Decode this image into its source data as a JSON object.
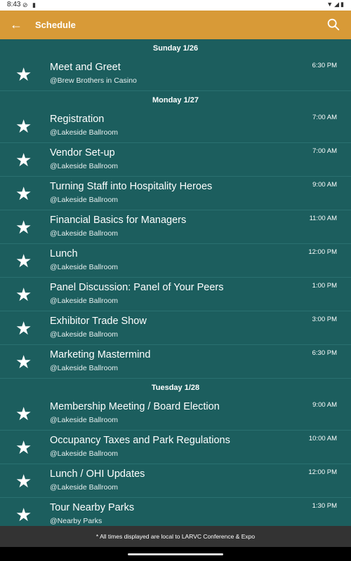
{
  "status": {
    "time": "8:43"
  },
  "appbar": {
    "title": "Schedule"
  },
  "days": [
    {
      "label": "Sunday 1/26",
      "events": [
        {
          "name": "Meet and Greet",
          "location": "@Brew Brothers in Casino",
          "time": "6:30 PM"
        }
      ]
    },
    {
      "label": "Monday 1/27",
      "events": [
        {
          "name": "Registration",
          "location": "@Lakeside Ballroom",
          "time": "7:00 AM"
        },
        {
          "name": "Vendor Set-up",
          "location": "@Lakeside Ballroom",
          "time": "7:00 AM"
        },
        {
          "name": "Turning Staff into Hospitality Heroes",
          "location": "@Lakeside Ballroom",
          "time": "9:00 AM"
        },
        {
          "name": "Financial Basics for Managers",
          "location": "@Lakeside Ballroom",
          "time": "11:00 AM"
        },
        {
          "name": "Lunch",
          "location": "@Lakeside Ballroom",
          "time": "12:00 PM"
        },
        {
          "name": "Panel Discussion: Panel of Your Peers",
          "location": "@Lakeside Ballroom",
          "time": "1:00 PM"
        },
        {
          "name": "Exhibitor Trade Show",
          "location": "@Lakeside Ballroom",
          "time": "3:00 PM"
        },
        {
          "name": "Marketing Mastermind",
          "location": "@Lakeside Ballroom",
          "time": "6:30 PM"
        }
      ]
    },
    {
      "label": "Tuesday 1/28",
      "events": [
        {
          "name": "Membership Meeting / Board Election",
          "location": "@Lakeside Ballroom",
          "time": "9:00 AM"
        },
        {
          "name": "Occupancy Taxes and Park Regulations",
          "location": "@Lakeside Ballroom",
          "time": "10:00 AM"
        },
        {
          "name": "Lunch / OHI Updates",
          "location": "@Lakeside Ballroom",
          "time": "12:00 PM"
        },
        {
          "name": "Tour Nearby Parks",
          "location": "@Nearby Parks",
          "time": "1:30 PM"
        }
      ]
    }
  ],
  "footer": {
    "text": "* All times displayed are local to LARVC Conference & Expo"
  },
  "icons": {
    "back": "arrow-left",
    "search": "magnifier",
    "favorite": "star"
  },
  "colors": {
    "appbar": "#d89a37",
    "background": "#1c5e5e"
  }
}
